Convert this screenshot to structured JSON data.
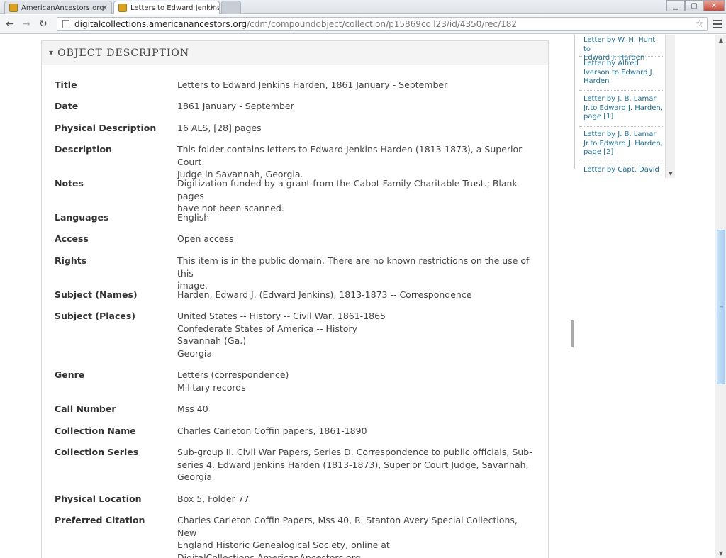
{
  "browser": {
    "tabs": [
      {
        "label": "AmericanAncestors.org"
      },
      {
        "label": "Letters to Edward Jenkins H"
      }
    ],
    "url_host": "digitalcollections.americanancestors.org",
    "url_path": "/cdm/compoundobject/collection/p15869coll23/id/4350/rec/182"
  },
  "panel": {
    "title": "OBJECT DESCRIPTION"
  },
  "fields": {
    "title": {
      "label": "Title",
      "value": "Letters to Edward Jenkins Harden, 1861 January - September"
    },
    "date": {
      "label": "Date",
      "value": "1861 January - September"
    },
    "physdesc": {
      "label": "Physical Description",
      "value": "16 ALS, [28] pages"
    },
    "description": {
      "label": "Description",
      "l1": "This folder contains letters to Edward Jenkins Harden (1813-1873), a Superior Court",
      "l2": "Judge in Savannah, Georgia."
    },
    "notes": {
      "label": "Notes",
      "l1": "Digitization funded by a grant from the Cabot Family Charitable Trust.; Blank pages",
      "l2": "have not been scanned."
    },
    "languages": {
      "label": "Languages",
      "value": "English"
    },
    "access": {
      "label": "Access",
      "value": "Open access"
    },
    "rights": {
      "label": "Rights",
      "l1": "This item is in the public domain. There are no known restrictions on the use of this",
      "l2": "image."
    },
    "subject_names": {
      "label": "Subject (Names)",
      "value": "Harden, Edward J. (Edward Jenkins), 1813-1873 -- Correspondence"
    },
    "subject_places": {
      "label": "Subject (Places)",
      "l1": "United States -- History -- Civil War, 1861-1865",
      "l2": "Confederate States of America -- History",
      "l3": "Savannah (Ga.)",
      "l4": "Georgia"
    },
    "genre": {
      "label": "Genre",
      "l1": "Letters (correspondence)",
      "l2": "Military records"
    },
    "call_number": {
      "label": "Call Number",
      "value": "Mss 40"
    },
    "collection_name": {
      "label": "Collection Name",
      "value": "Charles Carleton Coffin papers, 1861-1890"
    },
    "collection_series": {
      "label": "Collection Series",
      "l1": "Sub-group II. Civil War Papers, Series D. Correspondence to public officials, Sub-",
      "l2": "series 4. Edward Jenkins Harden (1813-1873), Superior Court Judge, Savannah,",
      "l3": "Georgia"
    },
    "physical_location": {
      "label": "Physical Location",
      "value": "Box 5, Folder 77"
    },
    "citation": {
      "label": "Preferred Citation",
      "l1": "Charles Carleton Coffin Papers, Mss 40, R. Stanton Avery Special Collections, New",
      "l2": "England Historic Genealogical Society, online at",
      "l3": "DigitalCollections.AmericanAncestors.org."
    }
  },
  "sidebar": {
    "items": [
      {
        "l1": "Letter by W. H. Hunt to",
        "l2": "Edward J. Harden",
        "l3": ""
      },
      {
        "l1": "Letter by Alfred",
        "l2": "Iverson to Edward J.",
        "l3": "Harden"
      },
      {
        "l1": "Letter by J. B. Lamar",
        "l2": "Jr.to Edward J. Harden,",
        "l3": "page [1]"
      },
      {
        "l1": "Letter by J. B. Lamar",
        "l2": "Jr.to Edward J. Harden,",
        "l3": "page [2]"
      },
      {
        "l1": "Letter by Capt. David S.",
        "l2": "",
        "l3": ""
      }
    ]
  }
}
